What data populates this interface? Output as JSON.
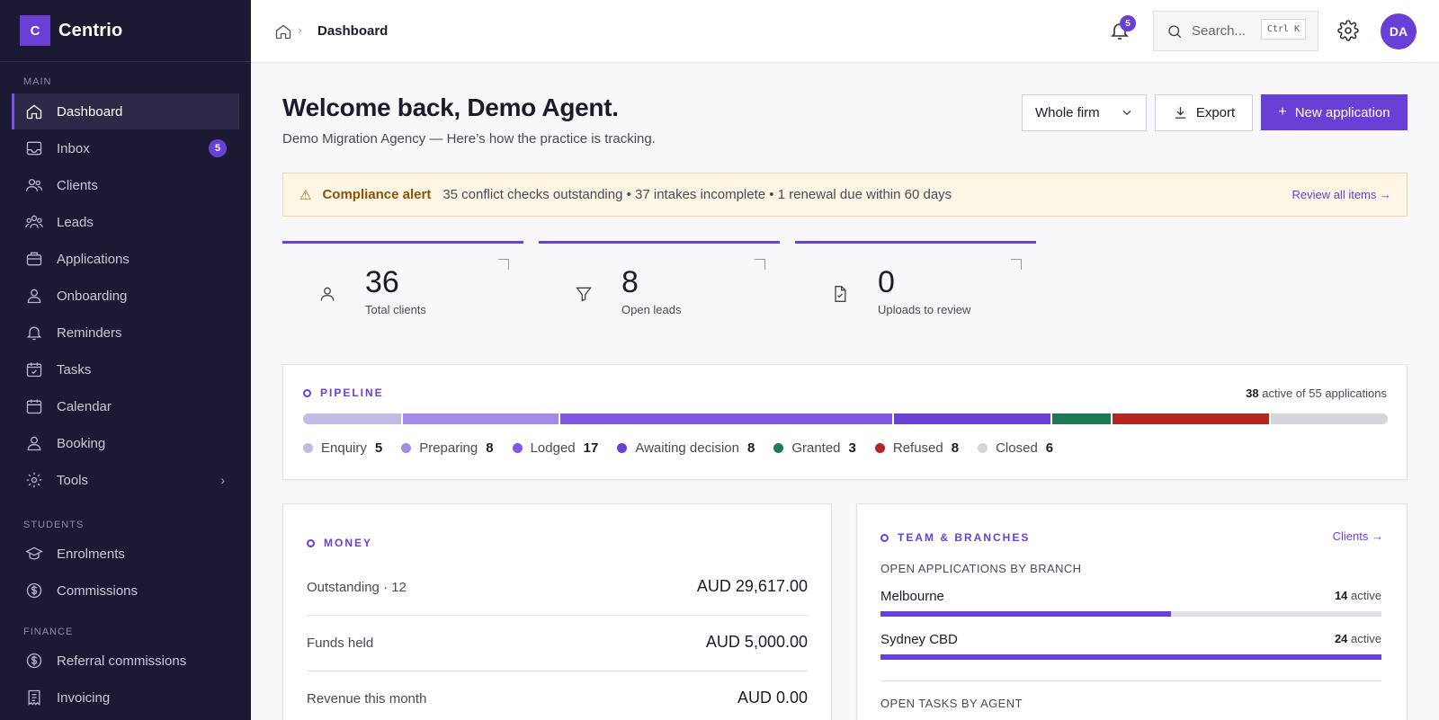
{
  "brand": {
    "logo_letter": "C",
    "name": "Centrio"
  },
  "sidebar": {
    "sections": {
      "main": "MAIN",
      "students": "STUDENTS",
      "finance": "FINANCE"
    },
    "items": [
      {
        "label": "Dashboard",
        "icon": "home-icon",
        "active": true
      },
      {
        "label": "Inbox",
        "icon": "inbox-icon",
        "badge": "5"
      },
      {
        "label": "Clients",
        "icon": "users-icon"
      },
      {
        "label": "Leads",
        "icon": "group-icon"
      },
      {
        "label": "Applications",
        "icon": "briefcase-icon"
      },
      {
        "label": "Onboarding",
        "icon": "user-icon"
      },
      {
        "label": "Reminders",
        "icon": "bell-icon"
      },
      {
        "label": "Tasks",
        "icon": "calendar-check-icon"
      },
      {
        "label": "Calendar",
        "icon": "calendar-icon"
      },
      {
        "label": "Booking",
        "icon": "person-icon"
      },
      {
        "label": "Tools",
        "icon": "gear-icon",
        "expandable": true
      },
      {
        "label": "Enrolments",
        "icon": "graduation-cap-icon"
      },
      {
        "label": "Commissions",
        "icon": "dollar-circle-icon"
      },
      {
        "label": "Referral commissions",
        "icon": "dollar-circle-icon"
      },
      {
        "label": "Invoicing",
        "icon": "receipt-icon"
      }
    ]
  },
  "topbar": {
    "breadcrumb_current": "Dashboard",
    "notifications_count": "5",
    "search_placeholder": "Search...",
    "search_shortcut": "Ctrl K",
    "avatar_initials": "DA"
  },
  "header": {
    "title": "Welcome back, Demo Agent.",
    "subtitle": "Demo Migration Agency — Here’s how the practice is tracking.",
    "scope_select": "Whole firm",
    "export_label": "Export",
    "new_label": "New application"
  },
  "alert": {
    "title": "Compliance alert",
    "text": "35 conflict checks outstanding • 37 intakes incomplete • 1 renewal due within 60 days",
    "link": "Review all items →"
  },
  "stats": [
    {
      "value": "36",
      "label": "Total clients",
      "icon": "user-icon"
    },
    {
      "value": "8",
      "label": "Open leads",
      "icon": "filter-icon"
    },
    {
      "value": "0",
      "label": "Uploads to review",
      "icon": "file-check-icon"
    }
  ],
  "pipeline": {
    "title": "PIPELINE",
    "summary_active": "38",
    "summary_text": "active of 55 applications",
    "stages": [
      {
        "name": "Enquiry",
        "count": 5,
        "color": "#c3bae6"
      },
      {
        "name": "Preparing",
        "count": 8,
        "color": "#a58ae6"
      },
      {
        "name": "Lodged",
        "count": 17,
        "color": "#8257e3"
      },
      {
        "name": "Awaiting decision",
        "count": 8,
        "color": "#6a3fd6"
      },
      {
        "name": "Granted",
        "count": 3,
        "color": "#1f7a53"
      },
      {
        "name": "Refused",
        "count": 8,
        "color": "#b5261e"
      },
      {
        "name": "Closed",
        "count": 6,
        "color": "#d5d5dc"
      }
    ]
  },
  "money": {
    "title": "MONEY",
    "rows": [
      {
        "label": "Outstanding · 12",
        "value": "AUD 29,617.00"
      },
      {
        "label": "Funds held",
        "value": "AUD 5,000.00"
      },
      {
        "label": "Revenue this month",
        "value": "AUD 0.00"
      }
    ]
  },
  "team": {
    "title": "TEAM & BRANCHES",
    "link": "Clients →",
    "branches_label": "OPEN APPLICATIONS BY BRANCH",
    "branches": [
      {
        "name": "Melbourne",
        "active": "14",
        "active_label": "active",
        "fill_pct": 58
      },
      {
        "name": "Sydney CBD",
        "active": "24",
        "active_label": "active",
        "fill_pct": 100
      }
    ],
    "tasks_label": "OPEN TASKS BY AGENT"
  }
}
